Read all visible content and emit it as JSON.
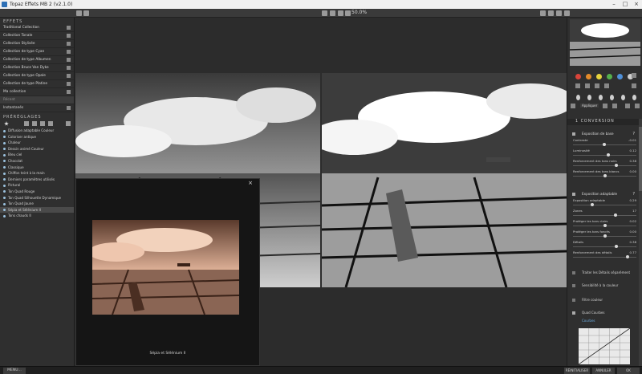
{
  "window": {
    "title": "Topaz Effets MB 2 (v2.1.0)",
    "zoom": "50.0%"
  },
  "left_panel": {
    "effects_header": "EFFETS",
    "collections": [
      "Traditional Collection",
      "Collection Tonale",
      "Collection Stylisée",
      "Collection de type Cyan",
      "Collection de type Albumen",
      "Collection Bruce Van Dyke",
      "Collection de type Opale",
      "Collection de type Platine",
      "Ma collection",
      "Récent",
      "Instantanés"
    ],
    "presets_header": "PRÉRÉGLAGES",
    "presets": [
      "Diffusion adaptable Couleur",
      "Coloriser antique",
      "Chaleur",
      "Dessin animé Couleur",
      "Bleu ciel",
      "Chocolat",
      "Classique",
      "Chiffon teint à la main",
      "Derniers paramètres utilisés",
      "Pictural",
      "Ton Quad Rouge",
      "Ton Quad Silhouette Dynamique",
      "Ton Quad Jaune",
      "Sépia et Sélénium II",
      "Tons chauds II"
    ],
    "selected_preset_index": 13,
    "selected_collection_index": 9
  },
  "popup": {
    "close": "×",
    "caption": "Sépia et Sélénium II"
  },
  "right_panel": {
    "apply_label": "Appliquer",
    "section_title": "1 CONVERSION",
    "basic_exposure": {
      "title": "Exposition de base",
      "help": "?",
      "rows": [
        {
          "name": "Contraste",
          "value": "-0.01",
          "level": 0.49
        },
        {
          "name": "Luminosité",
          "value": "0.12",
          "level": 0.56
        },
        {
          "name": "Renforcement des tons noirs",
          "value": "0.38",
          "level": 0.69
        },
        {
          "name": "Renforcement des tons blancs",
          "value": "0.00",
          "level": 0.5
        }
      ]
    },
    "adaptive_exposure": {
      "title": "Exposition adaptable",
      "help": "?",
      "rows": [
        {
          "name": "Exposition adaptable",
          "value": "0.29",
          "level": 0.29
        },
        {
          "name": "Zones",
          "value": "17",
          "level": 0.68
        },
        {
          "name": "Protéger les tons clairs",
          "value": "0.02",
          "level": 0.51
        },
        {
          "name": "Protéger les tons foncés",
          "value": "0.00",
          "level": 0.5
        },
        {
          "name": "Détails",
          "value": "0.38",
          "level": 0.69
        },
        {
          "name": "Renforcement des détails",
          "value": "0.77",
          "level": 0.88
        }
      ]
    },
    "separate_details": "Traiter les Détails séparément",
    "color_sensitivity": "Sensibilité à la couleur",
    "color_filter": "Filtre couleur",
    "quad_curves": "Quad Courbes",
    "curves_label": "Courbes"
  },
  "bottom": {
    "menu": "MENU...",
    "reset": "RÉINITIALISER",
    "cancel": "ANNULER",
    "ok": "OK"
  },
  "colors": {
    "swatches": [
      "#d9443a",
      "#e28a2a",
      "#e6d33d",
      "#55b04c",
      "#4f90d8",
      "#cfcfcf"
    ]
  }
}
